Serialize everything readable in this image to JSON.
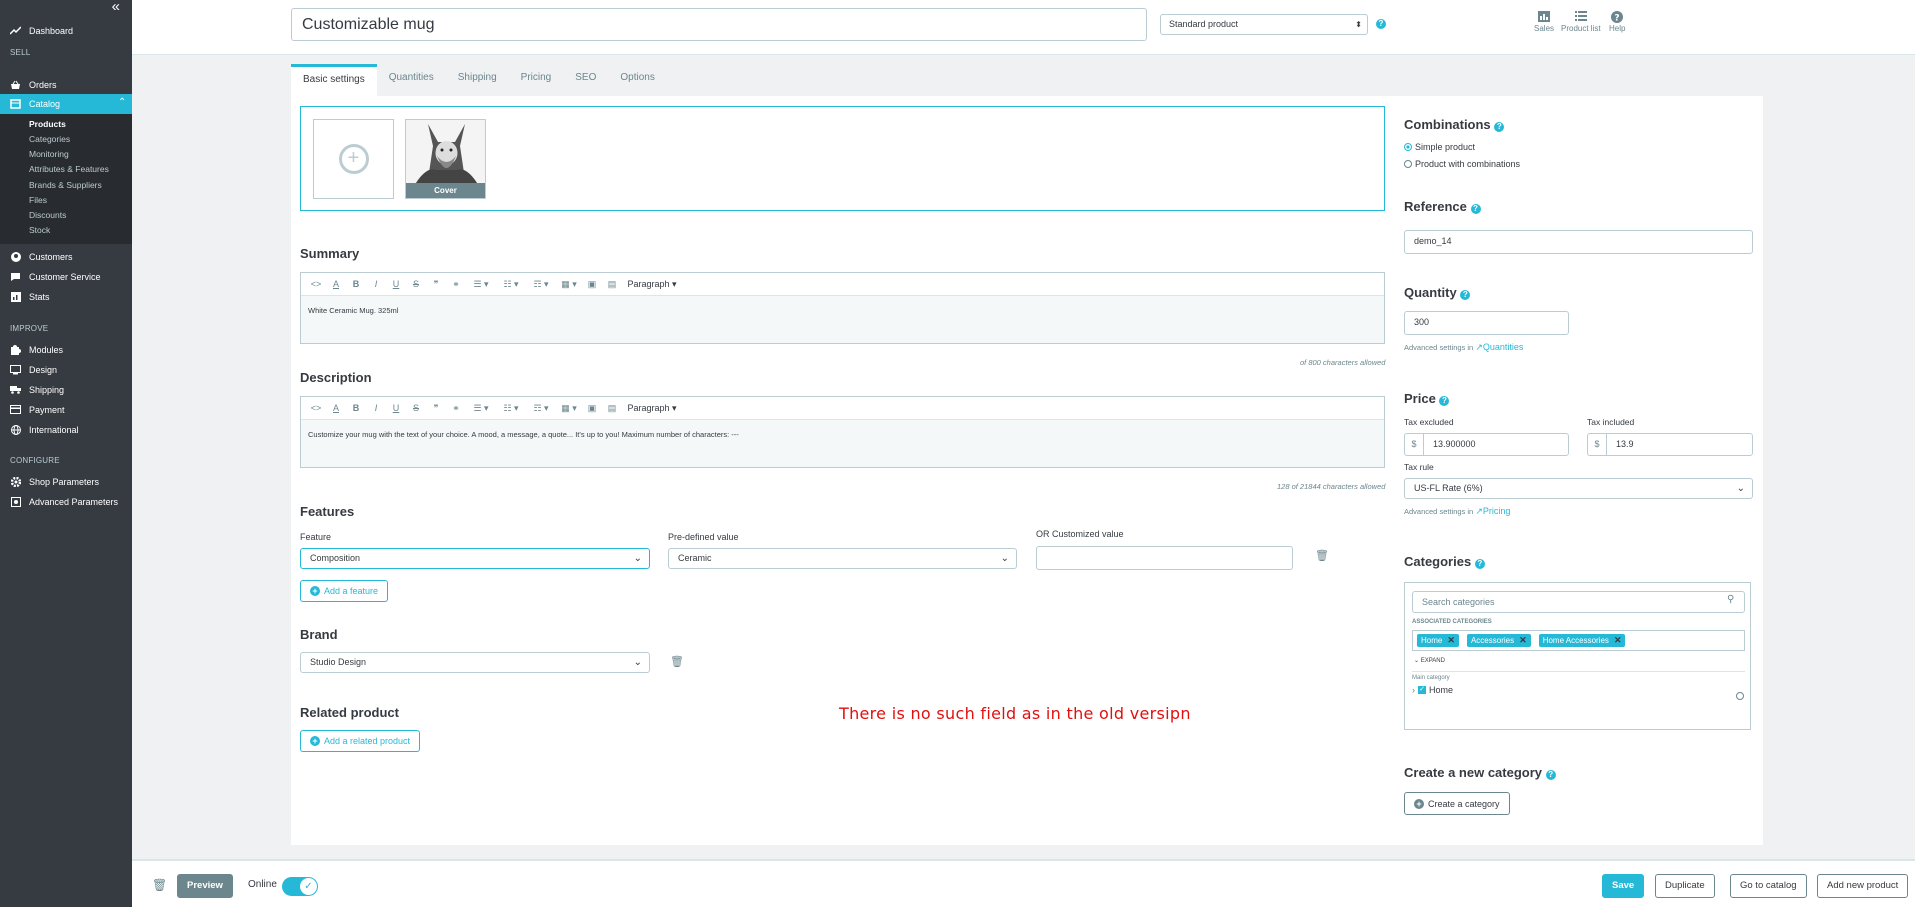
{
  "sidebar": {
    "dashboard": "Dashboard",
    "sell_section": "SELL",
    "orders": "Orders",
    "catalog": "Catalog",
    "catalog_items": [
      "Products",
      "Categories",
      "Monitoring",
      "Attributes & Features",
      "Brands & Suppliers",
      "Files",
      "Discounts",
      "Stock"
    ],
    "customers": "Customers",
    "customer_service": "Customer Service",
    "stats": "Stats",
    "improve_section": "IMPROVE",
    "modules": "Modules",
    "design": "Design",
    "shipping": "Shipping",
    "payment": "Payment",
    "international": "International",
    "configure_section": "CONFIGURE",
    "shop_parameters": "Shop Parameters",
    "advanced_parameters": "Advanced Parameters"
  },
  "header": {
    "product_name": "Customizable mug",
    "product_type": "Standard product",
    "tools": {
      "sales": "Sales",
      "product_list": "Product list",
      "help": "Help"
    }
  },
  "tabs": [
    "Basic settings",
    "Quantities",
    "Shipping",
    "Pricing",
    "SEO",
    "Options"
  ],
  "images": {
    "cover_label": "Cover"
  },
  "summary": {
    "title": "Summary",
    "format": "Paragraph",
    "text": "White Ceramic Mug. 325ml",
    "count": "of 800 characters allowed"
  },
  "description": {
    "title": "Description",
    "format": "Paragraph",
    "text": "Customize your mug with the text of your choice. A mood, a message, a quote... It's up to you! Maximum number of characters: ---",
    "count": "128 of 21844 characters allowed"
  },
  "features": {
    "title": "Features",
    "feature_label": "Feature",
    "feature_value": "Composition",
    "predefined_label": "Pre-defined value",
    "predefined_value": "Ceramic",
    "custom_label": "OR Customized value",
    "custom_value": "",
    "add_button": "Add a feature"
  },
  "brand": {
    "title": "Brand",
    "value": "Studio Design"
  },
  "related": {
    "title": "Related product",
    "add_button": "Add a related product"
  },
  "annotation": "There is no such field as in the old versipn",
  "combinations": {
    "title": "Combinations",
    "simple": "Simple product",
    "with_combinations": "Product with combinations",
    "selected": "simple"
  },
  "reference": {
    "title": "Reference",
    "value": "demo_14"
  },
  "quantity": {
    "title": "Quantity",
    "value": "300",
    "advanced_prefix": "Advanced settings in",
    "advanced_link": "Quantities"
  },
  "price": {
    "title": "Price",
    "tax_excluded_label": "Tax excluded",
    "tax_excluded_value": "13.900000",
    "tax_included_label": "Tax included",
    "tax_included_value": "13.9",
    "currency": "$",
    "tax_rule_label": "Tax rule",
    "tax_rule_value": "US-FL Rate (6%)",
    "advanced_prefix": "Advanced settings in",
    "advanced_link": "Pricing"
  },
  "categories": {
    "title": "Categories",
    "search_placeholder": "Search categories",
    "associated_label": "ASSOCIATED CATEGORIES",
    "associated": [
      "Home",
      "Accessories",
      "Home Accessories"
    ],
    "expand": "EXPAND",
    "main_label": "Main category",
    "tree_item": "Home"
  },
  "new_category": {
    "title": "Create a new category",
    "button": "Create a category"
  },
  "footer": {
    "preview": "Preview",
    "online": "Online",
    "online_state": true,
    "save": "Save",
    "duplicate": "Duplicate",
    "go_to_catalog": "Go to catalog",
    "add_new_product": "Add new product"
  },
  "colors": {
    "accent": "#25b9d7",
    "sidebar": "#363a41",
    "annotation": "#e20f0f"
  }
}
